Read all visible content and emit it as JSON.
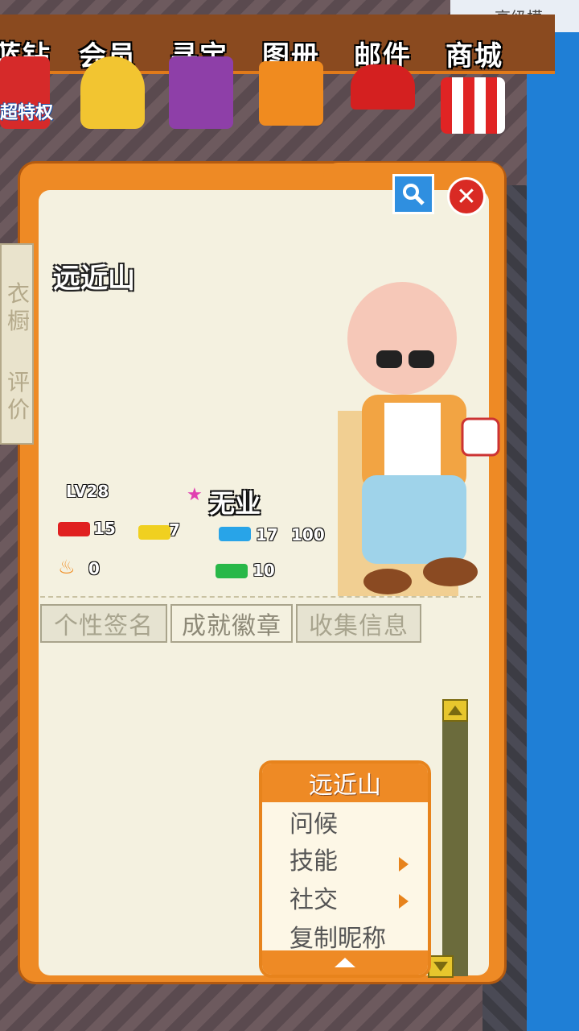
{
  "top_menu": {
    "items": [
      {
        "label": "蓝钻",
        "icon": "gift-icon"
      },
      {
        "label": "会员",
        "icon": "angel-icon"
      },
      {
        "label": "寻宝",
        "icon": "treasure-chest-icon"
      },
      {
        "label": "图册",
        "icon": "album-icon"
      },
      {
        "label": "邮件",
        "icon": "mailbox-icon"
      },
      {
        "label": "商城",
        "icon": "shop-icon"
      }
    ],
    "vip_label": "超特权"
  },
  "profile": {
    "nickname": "远近山",
    "side_tabs": [
      "衣橱",
      "评价"
    ],
    "level_label": "LV28",
    "job": "无业",
    "stats": {
      "red": "15",
      "yellow": "7",
      "blue": "17",
      "blue_max": "100",
      "fire": "0",
      "green": "10"
    },
    "tabs": [
      "个性签名",
      "成就徽章",
      "收集信息"
    ],
    "active_tab": "成就徽章"
  },
  "context_menu": {
    "title": "远近山",
    "items": [
      {
        "label": "问候",
        "has_submenu": false
      },
      {
        "label": "技能",
        "has_submenu": true
      },
      {
        "label": "社交",
        "has_submenu": true
      },
      {
        "label": "复制昵称",
        "has_submenu": false
      }
    ]
  },
  "top_right_text": "高级模",
  "colors": {
    "panel_orange": "#ee8a25",
    "panel_cream": "#f4f1e0",
    "close_red": "#d92a24",
    "search_blue": "#2f8fe0"
  }
}
